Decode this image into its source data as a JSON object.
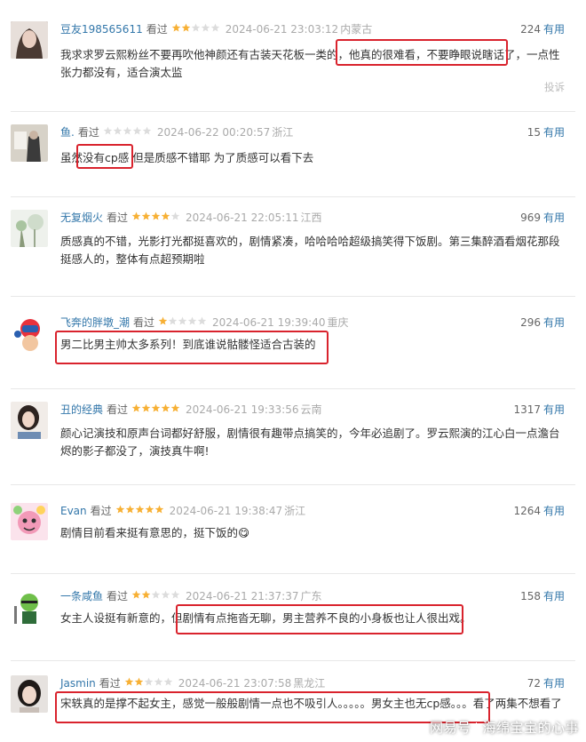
{
  "labels": {
    "watched": "看过",
    "useful": "有用",
    "report": "投诉"
  },
  "colors": {
    "star": "#f7b034",
    "star_empty": "#dcdcdc",
    "highlight": "#d9232d",
    "link": "#3377aa"
  },
  "reviews": [
    {
      "user": "豆友198565611",
      "rating": 2,
      "date": "2024-06-21 23:03:12",
      "location": "内蒙古",
      "useful_count": "224",
      "content": "我求求罗云熙粉丝不要再吹他神颜还有古装天花板一类的，他真的很难看，不要睁眼说瞎话了，一点性张力都没有，适合演太监"
    },
    {
      "user": "鱼.",
      "rating": 0,
      "date": "2024-06-22 00:20:57",
      "location": "浙江",
      "useful_count": "15",
      "content": "虽然没有cp感 但是质感不错耶 为了质感可以看下去"
    },
    {
      "user": "无复烟火",
      "rating": 4,
      "date": "2024-06-21 22:05:11",
      "location": "江西",
      "useful_count": "969",
      "content": "质感真的不错，光影打光都挺喜欢的，剧情紧凑，哈哈哈哈超级搞笑得下饭剧。第三集醉酒看烟花那段挺感人的，整体有点超预期啦"
    },
    {
      "user": "飞奔的胖墩_潮",
      "rating": 1,
      "date": "2024-06-21 19:39:40",
      "location": "重庆",
      "useful_count": "296",
      "content": "男二比男主帅太多系列！到底谁说骷髅怪适合古装的"
    },
    {
      "user": "丑的经典",
      "rating": 5,
      "date": "2024-06-21 19:33:56",
      "location": "云南",
      "useful_count": "1317",
      "content": "颜心记演技和原声台词都好舒服，剧情很有趣带点搞笑的，今年必追剧了。罗云熙演的江心白一点澹台烬的影子都没了，演技真牛啊!"
    },
    {
      "user": "Evan",
      "rating": 5,
      "date": "2024-06-21 19:38:47",
      "location": "浙江",
      "useful_count": "1264",
      "content": "剧情目前看来挺有意思的，挺下饭的😋"
    },
    {
      "user": "一条咸鱼",
      "rating": 2,
      "date": "2024-06-21 21:37:37",
      "location": "广东",
      "useful_count": "158",
      "content": "女主人设挺有新意的，但剧情有点拖沓无聊，男主营养不良的小身板也让人很出戏。"
    },
    {
      "user": "Jasmin",
      "rating": 2,
      "date": "2024-06-21 23:07:58",
      "location": "黑龙江",
      "useful_count": "72",
      "content": "宋轶真的是撑不起女主，感觉一般般剧情一点也不吸引人。。。。。男女主也无cp感。。。看了两集不想看了"
    }
  ],
  "watermark": {
    "source": "网易号",
    "author": "海绵宝宝的心事"
  }
}
